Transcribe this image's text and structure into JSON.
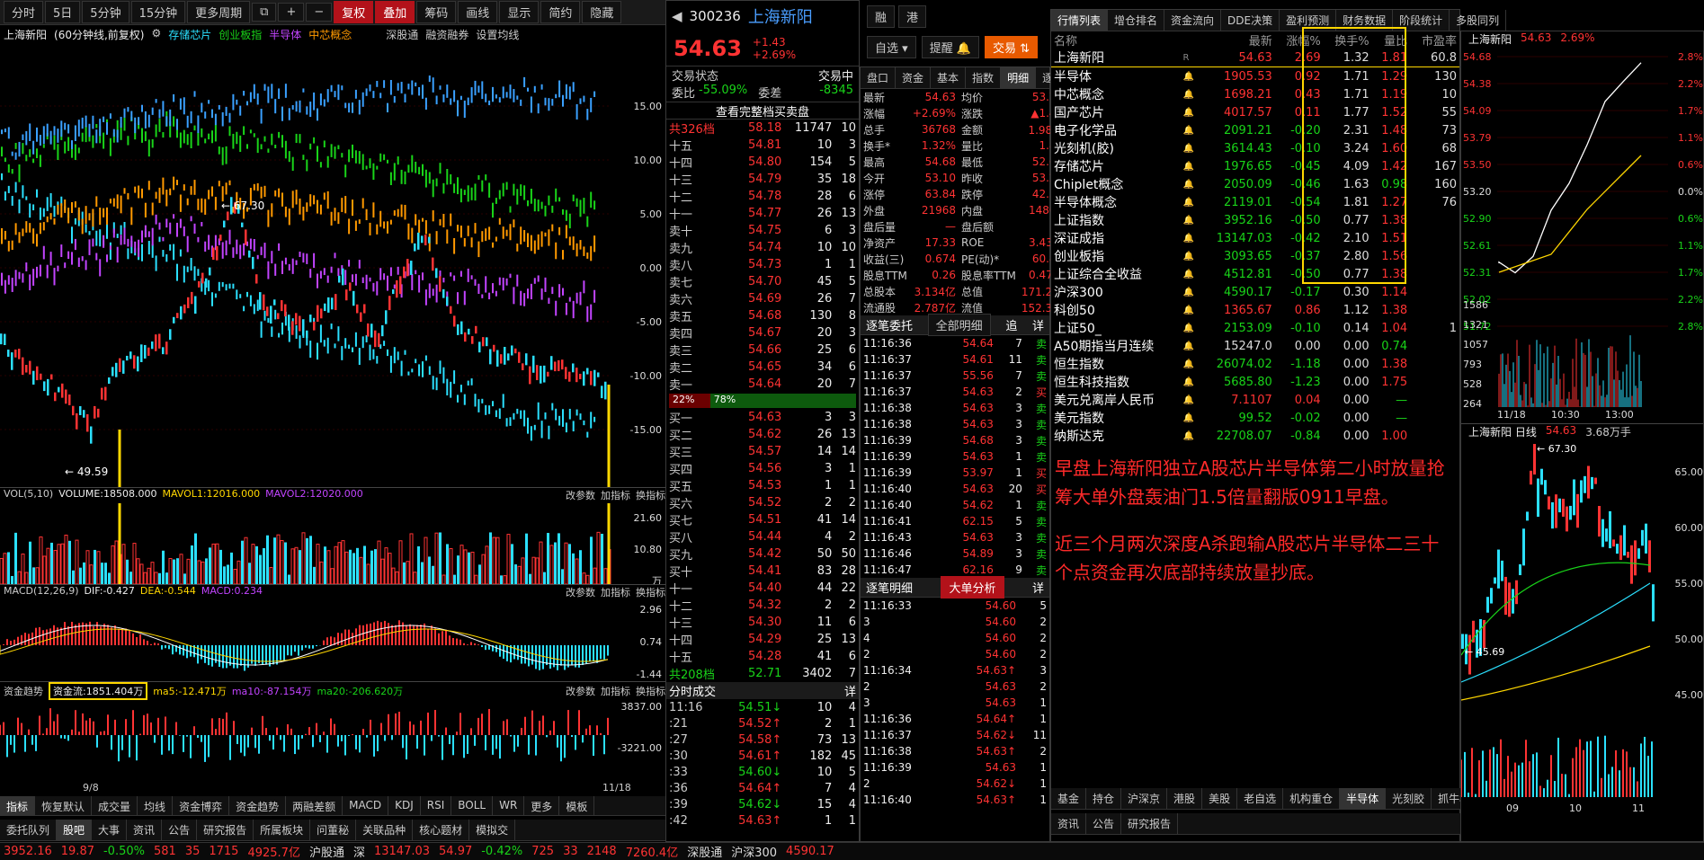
{
  "toolbar": {
    "buttons": [
      "分时",
      "5日",
      "5分钟",
      "15分钟",
      "更多周期",
      "复权",
      "叠加",
      "筹码",
      "画线",
      "显示",
      "简约",
      "隐藏"
    ],
    "icons": [
      "window-icon",
      "plus-icon",
      "minus-icon"
    ]
  },
  "chart": {
    "stock": "上海新阳",
    "info": "(60分钟线,前复权)",
    "overlays": [
      "存储芯片",
      "创业板指",
      "半导体",
      "中芯概念"
    ],
    "links": [
      "深股通",
      "融资融券",
      "设置均线"
    ],
    "low_label": "49.59",
    "high_label": "67.30",
    "pct_ticks": [
      "15.00",
      "10.00",
      "5.00",
      "0.00",
      "-5.00",
      "-10.00",
      "-15.00"
    ],
    "x_start": "9/8",
    "x_end": "11/18",
    "vol_label": "VOL(5,10)",
    "vol_value": "VOLUME:18508.000",
    "vol_ma1": "MAVOL1:12016.000",
    "vol_ma2": "MAVOL2:12020.000",
    "vol_ticks": [
      "21.60",
      "10.80",
      "万"
    ],
    "macd_label": "MACD(12,26,9)",
    "macd_dif": "DIF:-0.427",
    "macd_dea": "DEA:-0.544",
    "macd_val": "MACD:0.234",
    "macd_ticks": [
      "2.96",
      "0.74",
      "-1.44"
    ],
    "fund_label": "资金趋势",
    "fund_value": "资金流:1851.404万",
    "fund_ma5": "ma5:-12.471万",
    "fund_ma10": "ma10:-87.154万",
    "fund_ma20": "ma20:-206.620万",
    "fund_ticks": [
      "3837.00",
      "-3221.00"
    ],
    "ctrl": [
      "改参数",
      "加指标",
      "换指标"
    ],
    "bottom_tabs": [
      "指标",
      "恢复默认",
      "成交量",
      "均线",
      "资金博弈",
      "资金趋势",
      "两融差额",
      "MACD",
      "KDJ",
      "RSI",
      "BOLL",
      "WR",
      "更多",
      "模板"
    ],
    "news_tabs": [
      "委托队列",
      "股吧",
      "大事",
      "资讯",
      "公告",
      "研究报告",
      "所属板块",
      "问董秘",
      "关联品种",
      "核心题材",
      "模拟交"
    ]
  },
  "quote": {
    "code": "300236",
    "name": "上海新阳",
    "price": "54.63",
    "change": "+1.43",
    "pct": "+2.69%",
    "self_btn": "自选",
    "remind_btn": "提醒",
    "trade_btn": "交易",
    "state_label": "交易状态",
    "state_value": "交易中",
    "wb_label": "委比",
    "wb_value": "-55.09%",
    "wc_label": "委差",
    "wc_value": "-8345",
    "full_book": "查看完整档买卖盘",
    "sell_total": {
      "label": "共326档",
      "price": "58.18",
      "vol": "11747",
      "n": "10"
    },
    "sells": [
      [
        "十五",
        "54.81",
        "10",
        "3"
      ],
      [
        "十四",
        "54.80",
        "154",
        "5"
      ],
      [
        "十三",
        "54.79",
        "35",
        "18"
      ],
      [
        "十二",
        "54.78",
        "28",
        "6"
      ],
      [
        "十一",
        "54.77",
        "26",
        "13"
      ],
      [
        "卖十",
        "54.75",
        "6",
        "3"
      ],
      [
        "卖九",
        "54.74",
        "10",
        "10"
      ],
      [
        "卖八",
        "54.73",
        "1",
        "1"
      ],
      [
        "卖七",
        "54.70",
        "45",
        "5"
      ],
      [
        "卖六",
        "54.69",
        "26",
        "7"
      ],
      [
        "卖五",
        "54.68",
        "130",
        "8"
      ],
      [
        "卖四",
        "54.67",
        "20",
        "3"
      ],
      [
        "卖三",
        "54.66",
        "25",
        "6"
      ],
      [
        "卖二",
        "54.65",
        "34",
        "6"
      ],
      [
        "卖一",
        "54.64",
        "20",
        "7"
      ]
    ],
    "ratio_left": "22%",
    "ratio_right": "78%",
    "buys": [
      [
        "买一",
        "54.63",
        "3",
        "3"
      ],
      [
        "买二",
        "54.62",
        "26",
        "13"
      ],
      [
        "买三",
        "54.57",
        "14",
        "14"
      ],
      [
        "买四",
        "54.56",
        "3",
        "1"
      ],
      [
        "买五",
        "54.53",
        "1",
        "1"
      ],
      [
        "买六",
        "54.52",
        "2",
        "2"
      ],
      [
        "买七",
        "54.51",
        "41",
        "14"
      ],
      [
        "买八",
        "54.44",
        "4",
        "2"
      ],
      [
        "买九",
        "54.42",
        "50",
        "50"
      ],
      [
        "买十",
        "54.41",
        "83",
        "28"
      ],
      [
        "十一",
        "54.40",
        "44",
        "22"
      ],
      [
        "十二",
        "54.32",
        "2",
        "2"
      ],
      [
        "十三",
        "54.30",
        "11",
        "6"
      ],
      [
        "十四",
        "54.29",
        "25",
        "13"
      ],
      [
        "十五",
        "54.28",
        "41",
        "6"
      ]
    ],
    "buy_total": {
      "label": "共208档",
      "price": "52.71",
      "vol": "3402",
      "n": "7"
    },
    "ticks_title": "分时成交",
    "detail": "详",
    "ticks": [
      [
        "11:16",
        "54.51",
        "↓",
        "10",
        "4"
      ],
      [
        ":21",
        "54.52",
        "↑",
        "2",
        "1"
      ],
      [
        ":27",
        "54.58",
        "↑",
        "73",
        "13"
      ],
      [
        ":30",
        "54.61",
        "↑",
        "182",
        "45"
      ],
      [
        ":33",
        "54.60",
        "↓",
        "10",
        "5"
      ],
      [
        ":36",
        "54.64",
        "↑",
        "7",
        "4"
      ],
      [
        ":39",
        "54.62",
        "↓",
        "15",
        "4"
      ],
      [
        ":42",
        "54.63",
        "↑",
        "1",
        "1"
      ]
    ]
  },
  "detail": {
    "tabs": [
      "盘口",
      "资金",
      "基本",
      "指数",
      "明细",
      "逐笔"
    ],
    "rows": [
      [
        "最新",
        "54.63",
        "均价",
        "53.79"
      ],
      [
        "涨幅",
        "+2.69%",
        "涨跌",
        "▲1.43"
      ],
      [
        "总手",
        "36768",
        "金额",
        "1.98亿"
      ],
      [
        "换手*",
        "1.32%",
        "量比",
        "1.81"
      ],
      [
        "最高",
        "54.68",
        "最低",
        "52.68"
      ],
      [
        "今开",
        "53.10",
        "昨收",
        "53.20"
      ],
      [
        "涨停",
        "63.84",
        "跌停",
        "42.56"
      ],
      [
        "外盘",
        "21968",
        "内盘",
        "14800"
      ],
      [
        "盘后量",
        "—",
        "盘后额",
        "—"
      ],
      [
        "净资产",
        "17.33",
        "ROE",
        "3.43%"
      ],
      [
        "收益(三)",
        "0.674",
        "PE(动)*",
        "60.82"
      ],
      [
        "股息TTM",
        "0.26",
        "股息率TTM",
        "0.47%"
      ],
      [
        "总股本",
        "3.134亿",
        "总值",
        "171.2亿"
      ],
      [
        "流通股",
        "2.787亿",
        "流值",
        "152.3亿"
      ]
    ],
    "wt_title": "逐笔委托",
    "wt_filter": "全部明细",
    "wt_track": "追",
    "wt_detail": "详",
    "wt": [
      [
        "11:16:36",
        "54.64",
        "7",
        "卖"
      ],
      [
        "11:16:37",
        "54.61",
        "11",
        "卖"
      ],
      [
        "11:16:37",
        "55.56",
        "7",
        "卖"
      ],
      [
        "11:16:37",
        "54.63",
        "2",
        "买"
      ],
      [
        "11:16:38",
        "54.63",
        "3",
        "卖"
      ],
      [
        "11:16:38",
        "54.63",
        "3",
        "卖"
      ],
      [
        "11:16:39",
        "54.68",
        "3",
        "卖"
      ],
      [
        "11:16:39",
        "54.63",
        "1",
        "卖"
      ],
      [
        "11:16:39",
        "53.97",
        "1",
        "买"
      ],
      [
        "11:16:40",
        "54.63",
        "20",
        "买"
      ],
      [
        "11:16:40",
        "54.62",
        "1",
        "卖"
      ],
      [
        "11:16:41",
        "62.15",
        "5",
        "卖"
      ],
      [
        "11:16:43",
        "54.63",
        "3",
        "卖"
      ],
      [
        "11:16:46",
        "54.89",
        "3",
        "卖"
      ],
      [
        "11:16:47",
        "62.16",
        "9",
        "卖"
      ]
    ],
    "zb_title": "逐笔明细",
    "zb_btn": "大单分析",
    "zb_detail": "详",
    "zb": [
      [
        "11:16:33",
        "54.60",
        "",
        " 5"
      ],
      [
        "3",
        "54.60",
        "",
        "2"
      ],
      [
        "4",
        "54.60",
        "",
        "2"
      ],
      [
        "2",
        "54.60",
        "",
        "2"
      ],
      [
        "11:16:34",
        "54.63",
        "↑",
        "3"
      ],
      [
        "2",
        "54.63",
        "",
        "2"
      ],
      [
        "3",
        "54.63",
        "",
        "1"
      ],
      [
        "11:16:36",
        "54.64",
        "↑",
        "1"
      ],
      [
        "11:16:37",
        "54.62",
        "↓",
        "11"
      ],
      [
        "11:16:38",
        "54.63",
        "↑",
        "2"
      ],
      [
        "11:16:39",
        "54.63",
        "",
        "1"
      ],
      [
        "2",
        "54.62",
        "↓",
        "1"
      ],
      [
        "11:16:40",
        "54.63",
        "↑",
        "1"
      ]
    ]
  },
  "market": {
    "tabs": [
      "行情列表",
      "增仓排名",
      "资金流向",
      "DDE决策",
      "盈利预测",
      "财务数据",
      "阶段统计",
      "多股同列"
    ],
    "headers": [
      "名称",
      "",
      "最新",
      "涨幅%",
      "换手%",
      "量比",
      "市盈率"
    ],
    "rows": [
      [
        "上海新阳",
        "R",
        "54.63",
        "2.69",
        "1.32",
        "1.81",
        "60.8"
      ],
      [
        "半导体",
        "",
        "1905.53",
        "0.92",
        "1.71",
        "1.29",
        "130"
      ],
      [
        "中芯概念",
        "",
        "1698.21",
        "0.43",
        "1.71",
        "1.19",
        "10"
      ],
      [
        "国产芯片",
        "",
        "4017.57",
        "0.11",
        "1.77",
        "1.52",
        "55"
      ],
      [
        "电子化学品",
        "",
        "2091.21",
        "-0.20",
        "2.31",
        "1.48",
        "73"
      ],
      [
        "光刻机(胶)",
        "",
        "3614.43",
        "-0.10",
        "3.24",
        "1.60",
        "68"
      ],
      [
        "存储芯片",
        "",
        "1976.65",
        "-0.45",
        "4.09",
        "1.42",
        "167"
      ],
      [
        "Chiplet概念",
        "",
        "2050.09",
        "-0.46",
        "1.63",
        "0.98",
        "160"
      ],
      [
        "半导体概念",
        "",
        "2119.01",
        "-0.54",
        "1.81",
        "1.27",
        "76"
      ],
      [
        "上证指数",
        "",
        "3952.16",
        "-0.50",
        "0.77",
        "1.38",
        ""
      ],
      [
        "深证成指",
        "",
        "13147.03",
        "-0.42",
        "2.10",
        "1.51",
        ""
      ],
      [
        "创业板指",
        "",
        "3093.65",
        "-0.37",
        "2.80",
        "1.56",
        ""
      ],
      [
        "上证综合全收益",
        "",
        "4512.81",
        "-0.50",
        "0.77",
        "1.38",
        ""
      ],
      [
        "沪深300",
        "",
        "4590.17",
        "-0.17",
        "0.30",
        "1.14",
        ""
      ],
      [
        "科创50",
        "",
        "1365.67",
        "0.86",
        "1.12",
        "1.38",
        ""
      ],
      [
        "上证50_",
        "",
        "2153.09",
        "-0.10",
        "0.14",
        "1.04",
        "1"
      ],
      [
        "A50期指当月连续",
        "",
        "15247.0",
        "0.00",
        "0.00",
        "0.74",
        ""
      ],
      [
        "恒生指数",
        "",
        "26074.02",
        "-1.18",
        "0.00",
        "1.38",
        ""
      ],
      [
        "恒生科技指数",
        "",
        "5685.80",
        "-1.23",
        "0.00",
        "1.75",
        ""
      ],
      [
        "美元兑离岸人民币",
        "",
        "7.1107",
        "0.04",
        "0.00",
        "—",
        ""
      ],
      [
        "美元指数",
        "",
        "99.52",
        "-0.02",
        "0.00",
        "—",
        ""
      ],
      [
        "纳斯达克",
        "",
        "22708.07",
        "-0.84",
        "0.00",
        "1.00",
        ""
      ]
    ],
    "note1": "早盘上海新阳独立A股芯片半导体第二小时放量抢筹大单外盘轰油门1.5倍量翻版0911早盘。",
    "note2": "近三个月两次深度A杀跑输A股芯片半导体二三十个点资金再次底部持续放量抄底。",
    "bottom_tabs": [
      "基金",
      "持仓",
      "沪深京",
      "港股",
      "美股",
      "老自选",
      "机构重仓",
      "半导体",
      "光刻胶",
      "抓牛机会...",
      "设置自选"
    ],
    "news_tabs": [
      "资讯",
      "公告",
      "研究报告"
    ]
  },
  "mini": {
    "name": "上海新阳",
    "price": "54.63",
    "pct": "2.69%",
    "price_ticks": [
      "54.68",
      "54.38",
      "54.09",
      "53.79",
      "53.50",
      "53.20",
      "52.90",
      "52.61",
      "52.31",
      "52.02",
      "51.72"
    ],
    "pct_ticks": [
      "2.8%",
      "2.2%",
      "1.7%",
      "1.1%",
      "0.6%",
      "0.0%",
      "0.6%",
      "1.1%",
      "1.7%",
      "2.2%",
      "2.8%"
    ],
    "vol_ticks": [
      "1586",
      "1321",
      "1057",
      "793",
      "528",
      "264"
    ],
    "times": [
      "11/18",
      "10:30",
      "13:00"
    ],
    "day_title": "上海新阳 日线",
    "day_price": "54.63",
    "day_vol": "3.68万手",
    "day_high": "67.30",
    "day_low": "45.69",
    "day_ticks": [
      "65.00",
      "60.00",
      "55.00",
      "50.00",
      "45.00"
    ],
    "day_months": [
      "09",
      "10",
      "11"
    ]
  },
  "ticker": [
    "3952.16",
    "19.87",
    "-0.50%",
    "581",
    "35",
    "1715",
    "4925.7亿",
    "沪股通",
    "深",
    "13147.03",
    "54.97",
    "-0.42%",
    "725",
    "33",
    "2148",
    "7260.4亿",
    "深股通",
    "沪深300",
    "4590.17"
  ]
}
